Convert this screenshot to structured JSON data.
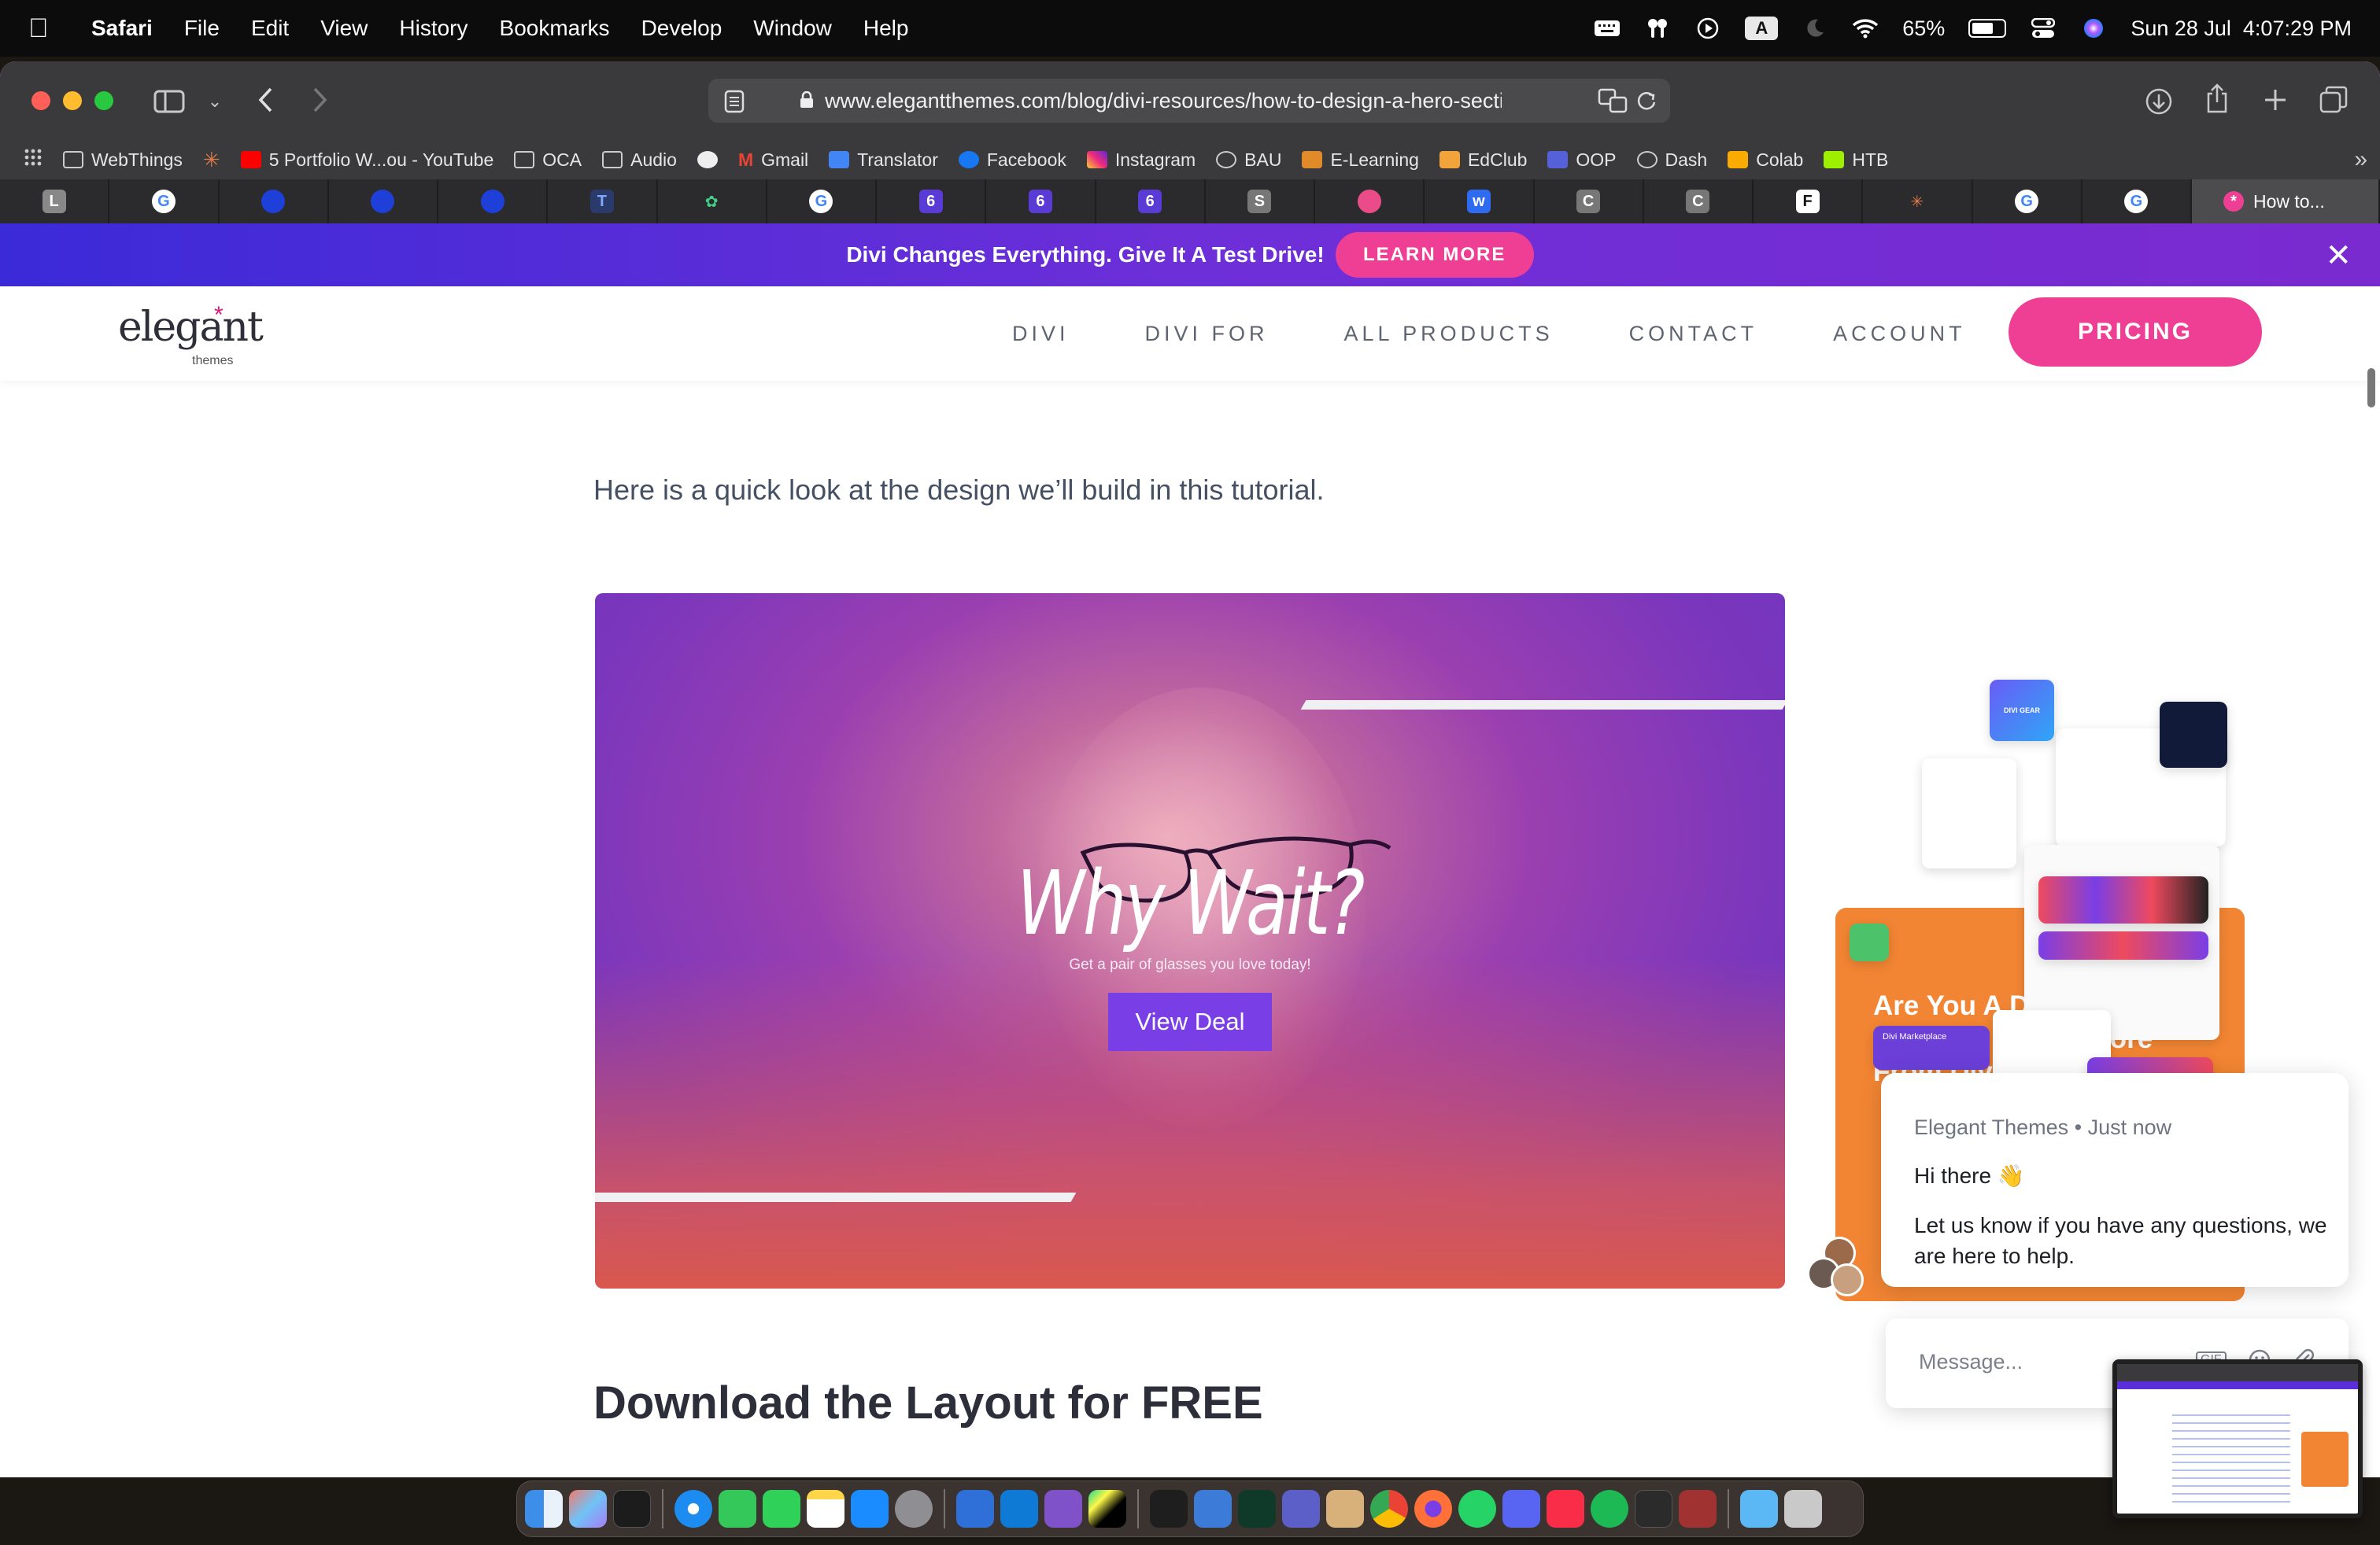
{
  "menubar": {
    "app_name": "Safari",
    "menus": [
      "File",
      "Edit",
      "View",
      "History",
      "Bookmarks",
      "Develop",
      "Window",
      "Help"
    ],
    "battery": "65%",
    "datetime": "Sun 28 Jul  4:07:29 PM",
    "input_source": "A"
  },
  "browser": {
    "url": "www.elegantthemes.com/blog/divi-resources/how-to-design-a-hero-section-wi",
    "bookmarks": [
      "WebThings",
      "5 Portfolio W...ou - YouTube",
      "OCA",
      "Audio",
      "Gmail",
      "Translator",
      "Facebook",
      "Instagram",
      "BAU",
      "E-Learning",
      "EdClub",
      "OOP",
      "Dash",
      "Colab",
      "HTB"
    ],
    "tab_favicons": [
      "L",
      "G",
      "e",
      "e",
      "e",
      "T",
      "leaf",
      "G",
      "6",
      "6",
      "6",
      "S",
      "dribbble",
      "w",
      "C",
      "C",
      "F",
      "claude",
      "G",
      "G"
    ],
    "active_tab_label": "How to..."
  },
  "promo": {
    "text": "Divi Changes Everything. Give It A Test Drive!",
    "cta": "LEARN MORE"
  },
  "nav": {
    "logo_word": "elegant",
    "logo_sub": "themes",
    "links": [
      "DIVI",
      "DIVI FOR",
      "ALL PRODUCTS",
      "CONTACT",
      "ACCOUNT"
    ],
    "pricing": "PRICING"
  },
  "article": {
    "intro": "Here is a quick look at the design we’ll build in this tutorial.",
    "hero_title": "Why Wait?",
    "hero_subtitle": "Get a pair of glasses you love today!",
    "hero_cta": "View Deal",
    "download_heading": "Download the Layout for FREE"
  },
  "sidebar_ad": {
    "heading": "Are You A Divi User? Find Out How To Get More From Divi! 👇",
    "collage_label_marketplace": "Divi Marketplace",
    "collage_label_gear": "DIVI GEAR"
  },
  "chat": {
    "sender": "Elegant Themes",
    "time": "Just now",
    "greeting": "Hi there 👋",
    "message": "Let us know if you have any questions, we are here to help.",
    "input_placeholder": "Message..."
  },
  "colors": {
    "brand_pink": "#ee3f94",
    "promo_purple": "#5a2ed8",
    "ad_orange": "#f28533",
    "hero_button": "#7a3ee6"
  }
}
